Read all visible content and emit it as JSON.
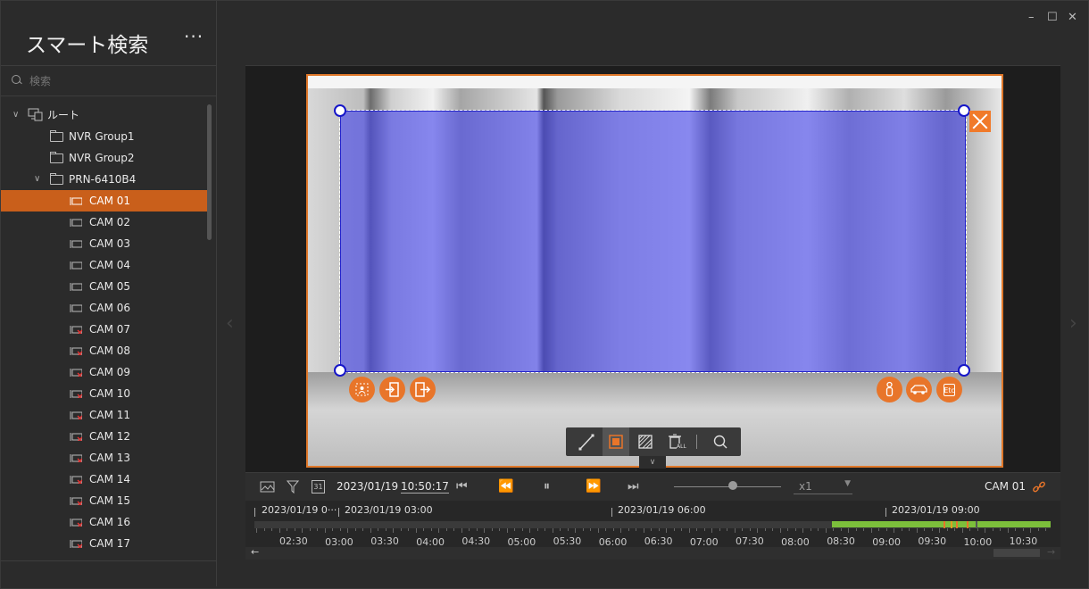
{
  "sidebar": {
    "title": "スマート検索",
    "more": "···",
    "search_placeholder": "検索",
    "root": "ルート",
    "groups": [
      "NVR Group1",
      "NVR Group2",
      "PRN-6410B4"
    ],
    "cameras": [
      "CAM 01",
      "CAM 02",
      "CAM 03",
      "CAM 04",
      "CAM 05",
      "CAM 06",
      "CAM 07",
      "CAM 08",
      "CAM 09",
      "CAM 10",
      "CAM 11",
      "CAM 12",
      "CAM 13",
      "CAM 14",
      "CAM 15",
      "CAM 16",
      "CAM 17"
    ],
    "selected_camera": "CAM 01",
    "offline_from_index": 6
  },
  "window_controls": {
    "minimize": "–",
    "maximize": "☐",
    "close": "✕"
  },
  "overlay": {
    "etc_label": "Etc",
    "delete_all_label": "ALL"
  },
  "playback": {
    "calendar_day": "31",
    "date": "2023/01/19",
    "time": "10:50:17",
    "speed": "x1",
    "camera": "CAM 01"
  },
  "timeline": {
    "dates": [
      "2023/01/19 0···",
      "2023/01/19 03:00",
      "2023/01/19 06:00",
      "2023/01/19 09:00"
    ],
    "hours": [
      "02:30",
      "03:00",
      "03:30",
      "04:00",
      "04:30",
      "05:00",
      "05:30",
      "06:00",
      "06:30",
      "07:00",
      "07:30",
      "08:00",
      "08:30",
      "09:00",
      "09:30",
      "10:00",
      "10:30"
    ],
    "left_arrow": "←",
    "right_arrow": "→"
  },
  "colors": {
    "accent": "#e8752a",
    "selection": "#c95f1b",
    "roi": "#4646eb",
    "recording": "#7cbf3b"
  }
}
